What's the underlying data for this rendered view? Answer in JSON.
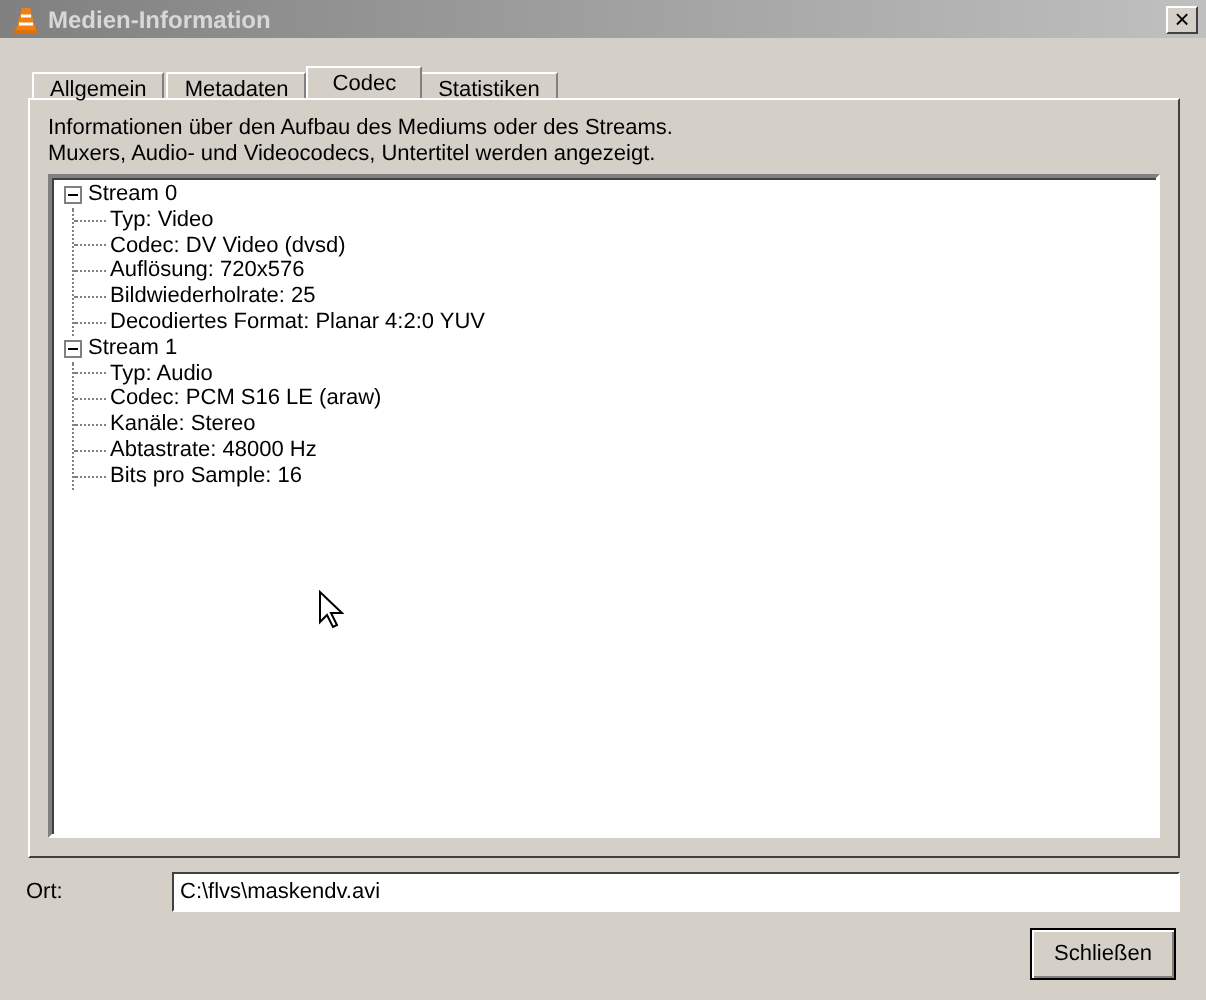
{
  "window": {
    "title": "Medien-Information",
    "close": "×"
  },
  "tabs": [
    {
      "label": "Allgemein",
      "selected": false
    },
    {
      "label": "Metadaten",
      "selected": false
    },
    {
      "label": "Codec",
      "selected": true
    },
    {
      "label": "Statistiken",
      "selected": false
    }
  ],
  "description": [
    "Informationen über den Aufbau des Mediums oder des Streams.",
    "Muxers, Audio- und Videocodecs, Untertitel werden angezeigt."
  ],
  "tree": [
    {
      "label": "Stream 0",
      "expanded": true,
      "children": [
        {
          "label": "Typ: Video"
        },
        {
          "label": "Codec: DV Video (dvsd)"
        },
        {
          "label": "Auflösung: 720x576"
        },
        {
          "label": "Bildwiederholrate: 25"
        },
        {
          "label": "Decodiertes Format: Planar 4:2:0 YUV"
        }
      ]
    },
    {
      "label": "Stream 1",
      "expanded": true,
      "children": [
        {
          "label": "Typ: Audio"
        },
        {
          "label": "Codec: PCM S16 LE (araw)"
        },
        {
          "label": "Kanäle: Stereo"
        },
        {
          "label": "Abtastrate: 48000 Hz"
        },
        {
          "label": "Bits pro Sample: 16"
        }
      ]
    }
  ],
  "location": {
    "label": "Ort:",
    "value": "C:\\flvs\\maskendv.avi"
  },
  "buttons": [
    "Schließen"
  ]
}
